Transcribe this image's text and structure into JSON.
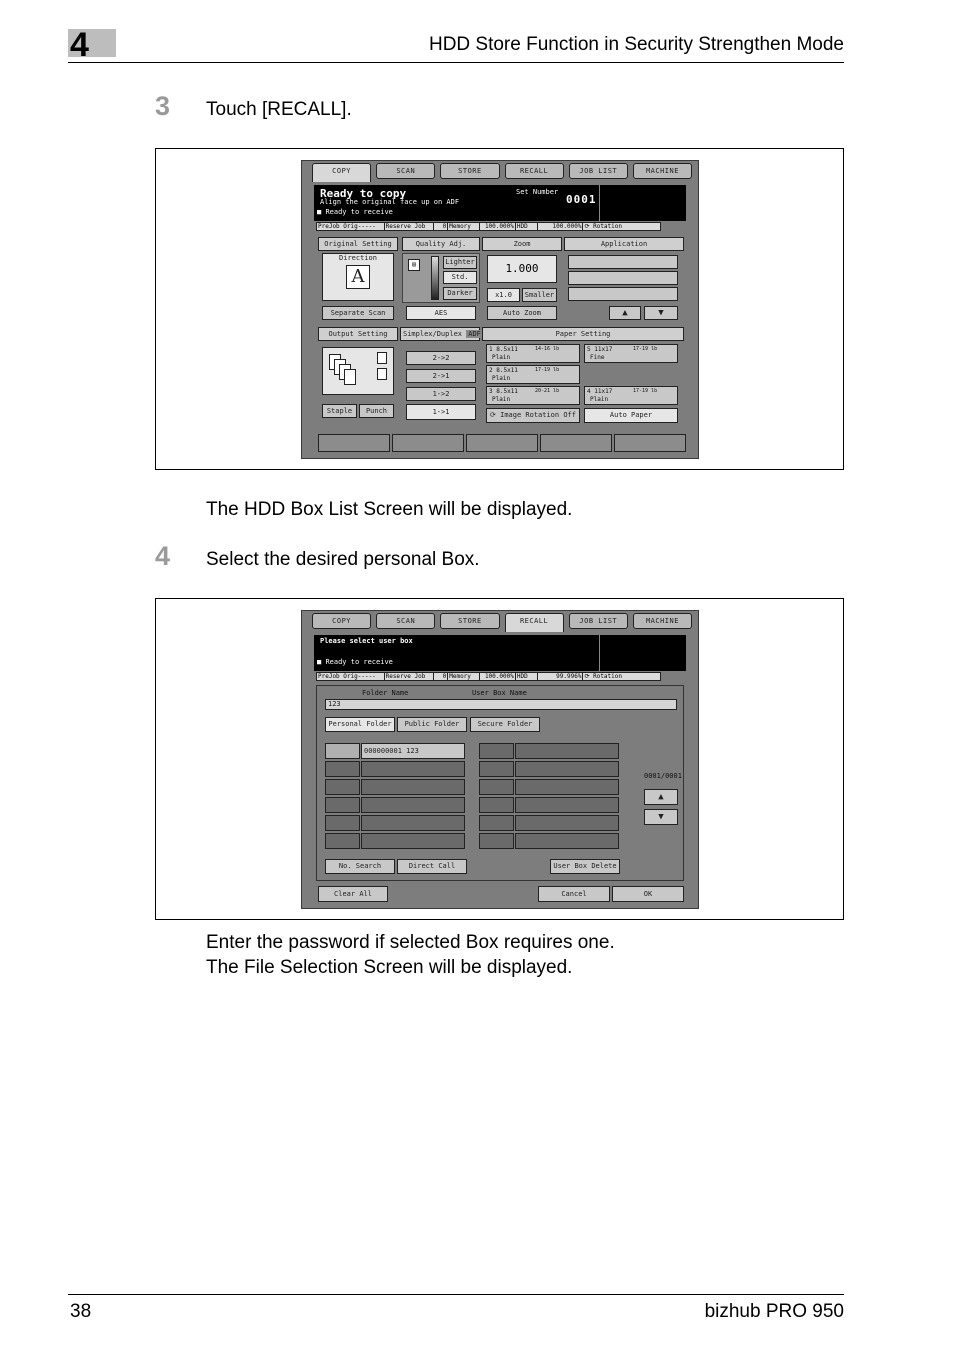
{
  "header": {
    "chapter": "4",
    "title": "HDD Store Function in Security Strengthen Mode"
  },
  "step3": {
    "number": "3",
    "text": "Touch [RECALL].",
    "after": "The HDD Box List Screen will be displayed."
  },
  "step4": {
    "number": "4",
    "text": "Select the desired personal Box.",
    "after1": "Enter the password if selected Box requires one.",
    "after2": "The File Selection Screen will be displayed."
  },
  "tabs": [
    "COPY",
    "SCAN",
    "STORE",
    "RECALL",
    "JOB LIST",
    "MACHINE"
  ],
  "screen1": {
    "msg_main": "Ready to copy",
    "msg_sub": "Align the original face up on ADF",
    "msg_small": "Ready to receive",
    "set_number_label": "Set Number",
    "set_number": "0001",
    "status": [
      "PreJob Orig-----",
      "Reserve Job",
      "0",
      "Memory",
      "100.000%",
      "HDD",
      "100.000%",
      "Rotation"
    ],
    "original_setting": "Original Setting",
    "direction": "Direction",
    "direction_glyph": "A",
    "separate_scan": "Separate Scan",
    "quality_adj": "Quality Adj.",
    "lighter": "Lighter",
    "std": "Std.",
    "darker": "Darker",
    "aes": "AES",
    "zoom": "Zoom",
    "zoom_value": "1.000",
    "x1": "x1.0",
    "smaller": "Smaller",
    "auto_zoom": "Auto Zoom",
    "application": "Application",
    "output_setting": "Output Setting",
    "staple": "Staple",
    "punch": "Punch",
    "simplex": "Simplex/Duplex",
    "adf": "ADF",
    "duplex": [
      "2->2",
      "2->1",
      "1->2",
      "1->1"
    ],
    "paper_setting": "Paper Setting",
    "trays": [
      {
        "n": "1",
        "size": "8.5x11",
        "weight": "14-16 lb",
        "type": "Plain"
      },
      {
        "n": "2",
        "size": "8.5x11",
        "weight": "17-19 lb",
        "type": "Plain"
      },
      {
        "n": "3",
        "size": "8.5x11",
        "weight": "20-21 lb",
        "type": "Plain"
      },
      {
        "n": "5",
        "size": "11x17",
        "weight": "17-19 lb",
        "type": "Fine"
      },
      {
        "n": "4",
        "size": "11x17",
        "weight": "17-19 lb",
        "type": "Plain"
      }
    ],
    "image_rotation": "Image Rotation Off",
    "auto_paper": "Auto Paper"
  },
  "screen2": {
    "msg_main": "Please select user box",
    "msg_small": "Ready to receive",
    "status": [
      "PreJob Orig-----",
      "Reserve Job",
      "0",
      "Memory",
      "100.000%",
      "HDD",
      "99.996%",
      "Rotation"
    ],
    "folder_name": "Folder Name",
    "user_box_name": "User Box Name",
    "folder_value": "123",
    "personal": "Personal Folder",
    "public": "Public Folder",
    "secure": "Secure Folder",
    "first_box": "000000001 123",
    "page": "0001/0001",
    "no_search": "No. Search",
    "direct_call": "Direct Call",
    "user_box_delete": "User Box Delete",
    "clear_all": "Clear All",
    "cancel": "Cancel",
    "ok": "OK"
  },
  "footer": {
    "page": "38",
    "product": "bizhub PRO 950"
  }
}
